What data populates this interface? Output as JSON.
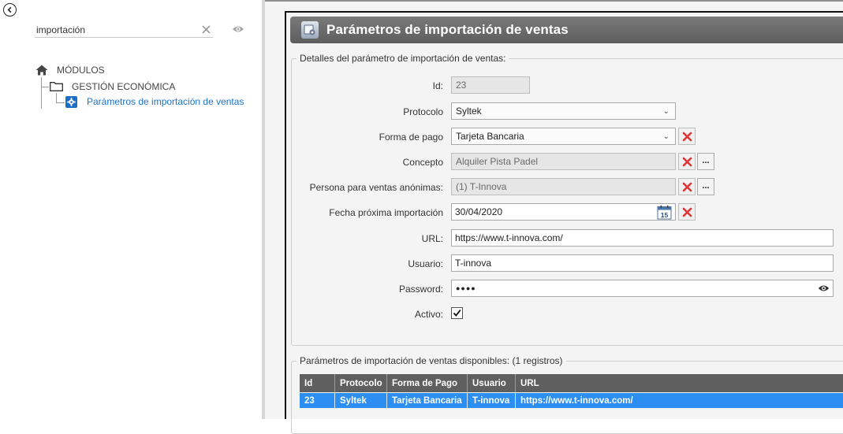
{
  "search": {
    "value": "importación"
  },
  "tree": {
    "root_label": "MÓDULOS",
    "folder_label": "GESTIÓN ECONÓMICA",
    "leaf_label": "Parámetros de importación de ventas"
  },
  "window": {
    "title": "Parámetros de importación de ventas"
  },
  "details": {
    "legend": "Detalles del parámetro de importación de ventas:",
    "id": {
      "label": "Id:",
      "value": "23"
    },
    "protocolo": {
      "label": "Protocolo",
      "value": "Syltek"
    },
    "forma_pago": {
      "label": "Forma de pago",
      "value": "Tarjeta Bancaria"
    },
    "concepto": {
      "label": "Concepto",
      "value": "Alquiler Pista Padel"
    },
    "persona": {
      "label": "Persona para ventas anónimas:",
      "value": "(1) T-Innova"
    },
    "fecha": {
      "label": "Fecha próxima importación",
      "value": "30/04/2020"
    },
    "url": {
      "label": "URL:",
      "value": "https://www.t-innova.com/"
    },
    "usuario": {
      "label": "Usuario:",
      "value": "T-innova"
    },
    "password": {
      "label": "Password:",
      "value": "●●●●"
    },
    "activo": {
      "label": "Activo:",
      "checked": true
    },
    "ellipsis_label": "...",
    "calendar_day": "15"
  },
  "list": {
    "legend": "Parámetros de importación de ventas disponibles:  (1 registros)",
    "columns": [
      "Id",
      "Protocolo",
      "Forma de Pago",
      "Usuario",
      "URL"
    ],
    "rows": [
      [
        "23",
        "Syltek",
        "Tarjeta Bancaria",
        "T-innova",
        "https://www.t-innova.com/"
      ]
    ]
  },
  "colors": {
    "title_bar": "#6b6b6b",
    "selected_row": "#2b8ef0",
    "link_blue": "#1d72c8",
    "delete_red": "#e03535"
  }
}
